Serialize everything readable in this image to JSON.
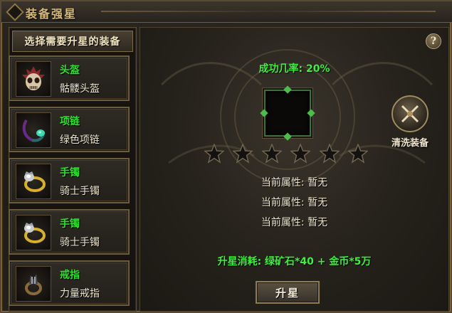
{
  "window": {
    "title": "装备强星"
  },
  "left_panel": {
    "header": "选择需要升星的装备",
    "items": [
      {
        "slot": "头盔",
        "name": "骷髅头盔",
        "icon": "skull-helmet-icon"
      },
      {
        "slot": "项链",
        "name": "绿色项链",
        "icon": "green-necklace-icon"
      },
      {
        "slot": "手镯",
        "name": "骑士手镯",
        "icon": "knight-bracelet-icon"
      },
      {
        "slot": "手镯",
        "name": "骑士手镯",
        "icon": "knight-bracelet-icon"
      },
      {
        "slot": "戒指",
        "name": "力量戒指",
        "icon": "power-ring-icon"
      }
    ]
  },
  "main": {
    "help_label": "?",
    "success_rate": "成功几率: 20%",
    "star_count": 6,
    "attributes": [
      {
        "text": "当前属性:  暂无"
      },
      {
        "text": "当前属性:  暂无"
      },
      {
        "text": "当前属性:  暂无"
      }
    ],
    "cost": "升星消耗: 绿矿石*40 + 金币*5万",
    "upgrade_label": "升星",
    "wash_label": "清洗装备"
  },
  "colors": {
    "accent_green": "#3ef03e",
    "border_gold": "#8a7448"
  }
}
